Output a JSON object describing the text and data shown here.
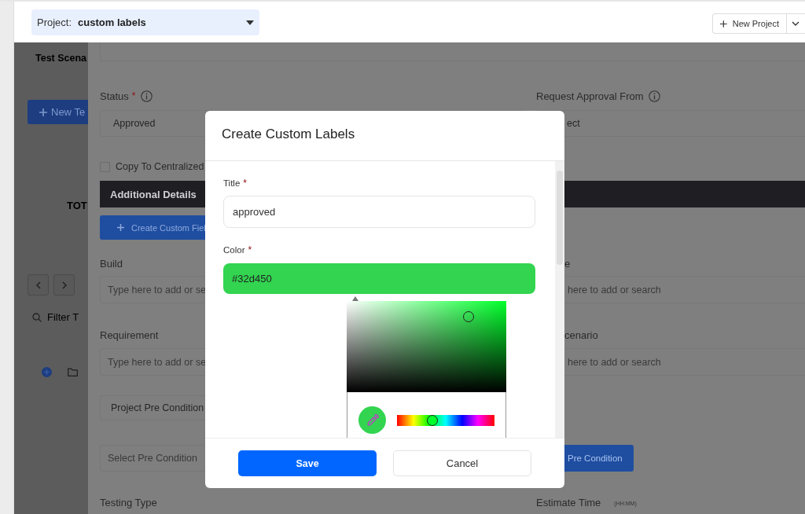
{
  "project_selector": {
    "label": "Project:",
    "value": "custom labels"
  },
  "new_project_button": {
    "label": "New Project"
  },
  "sidebar": {
    "title": "Test Scena",
    "new_button": "New Te",
    "total_label": "TOT",
    "filter_placeholder": "Filter T"
  },
  "form": {
    "status": {
      "label": "Status",
      "mark": "*",
      "value": "Approved"
    },
    "request_approval": {
      "label": "Request Approval From",
      "placeholder": "ect"
    },
    "copy_checkbox": {
      "label": "Copy To Centralized",
      "checked": false
    },
    "section_title": "Additional Details",
    "create_field_button": "Create Custom Fiel",
    "build": {
      "label": "Build",
      "placeholder": "Type here to add or se"
    },
    "field_right_1": {
      "label": "e",
      "placeholder": "here to add or search"
    },
    "requirement": {
      "label": "Requirement",
      "placeholder": "Type here to add or se"
    },
    "field_right_2": {
      "label": "cenario",
      "placeholder": "here to add or search"
    },
    "pre_condition_box": "Project Pre Condition",
    "pre_condition_select": {
      "placeholder": "Select Pre Condition"
    },
    "pre_condition_button": "Pre Condition",
    "testing_type": "Testing Type",
    "estimate_time": {
      "label": "Estimate Time",
      "hint": "(HH:MM)"
    }
  },
  "dialog": {
    "title": "Create Custom Labels",
    "fields": [
      {
        "label": "Title",
        "mark": "*",
        "value": "approved",
        "kind": "text"
      },
      {
        "label": "Color",
        "mark": "*",
        "value": "#32d450",
        "kind": "color"
      }
    ],
    "hue_slider": {
      "level": 0.36
    },
    "buttons": [
      {
        "label": "Save",
        "kind": "primary"
      },
      {
        "label": "Cancel",
        "kind": "secondary"
      }
    ]
  }
}
